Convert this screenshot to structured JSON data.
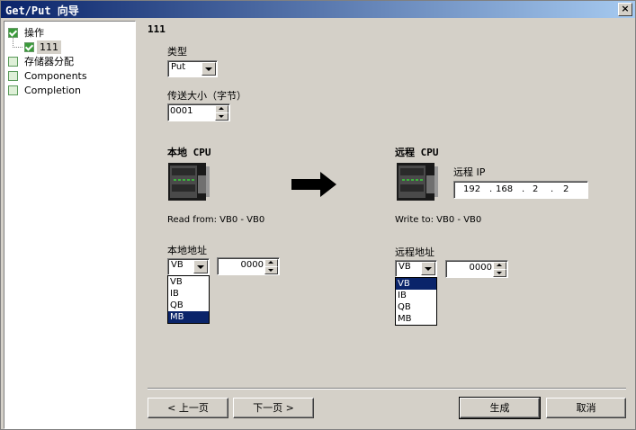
{
  "window": {
    "title": "Get/Put 向导",
    "close_label": "×"
  },
  "tree": {
    "items": [
      {
        "label": "操作",
        "checked": true
      },
      {
        "label": "111",
        "checked": true
      },
      {
        "label": "存储器分配",
        "checked": false
      },
      {
        "label": "Components",
        "checked": false
      },
      {
        "label": "Completion",
        "checked": false
      }
    ]
  },
  "page": {
    "heading": "111",
    "type_label": "类型",
    "type_value": "Put",
    "size_label": "传送大小（字节）",
    "size_value": "0001"
  },
  "local": {
    "heading": "本地 CPU",
    "action_text": "Read from: VB0 - VB0",
    "address_label": "本地地址",
    "area_value": "VB",
    "offset_value": "0000",
    "area_options": [
      "VB",
      "IB",
      "QB",
      "MB"
    ],
    "highlighted_option": "MB"
  },
  "remote": {
    "heading": "远程 CPU",
    "ip_label": "远程 IP",
    "ip": [
      "192",
      "168",
      "2",
      "2"
    ],
    "ip_sep": ".",
    "action_text": "Write to: VB0 - VB0",
    "address_label": "远程地址",
    "area_value": "VB",
    "offset_value": "0000",
    "area_options": [
      "VB",
      "IB",
      "QB",
      "MB"
    ],
    "highlighted_option": "VB"
  },
  "buttons": {
    "prev": "< 上一页",
    "next": "下一页 >",
    "finish": "生成",
    "cancel": "取消"
  },
  "colors": {
    "title_bar": "#0a246a",
    "selection": "#0a246a",
    "check_green": "#3a9a3a",
    "face": "#d4d0c8"
  }
}
